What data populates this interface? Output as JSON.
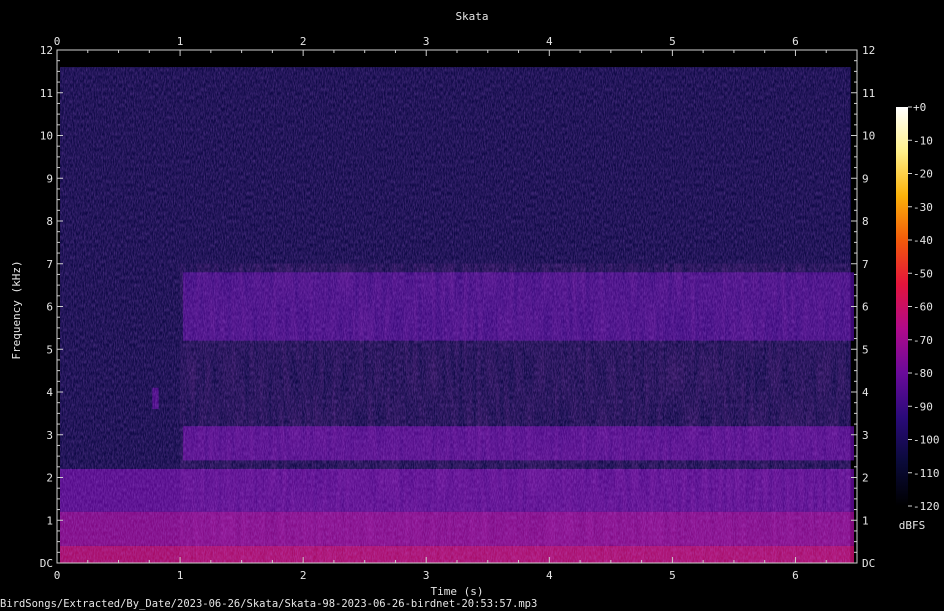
{
  "chart_data": {
    "type": "heatmap",
    "title": "Skata",
    "xlabel": "Time (s)",
    "ylabel": "Frequency (kHz)",
    "xlim": [
      0,
      6.5
    ],
    "ylim": [
      0,
      12
    ],
    "x_ticks": [
      "0",
      "1",
      "2",
      "3",
      "4",
      "5",
      "6"
    ],
    "y_ticks": [
      "DC",
      "1",
      "2",
      "3",
      "4",
      "5",
      "6",
      "7",
      "8",
      "9",
      "10",
      "11",
      "12"
    ],
    "colorbar": {
      "label": "dBFS",
      "range": [
        -120,
        0
      ],
      "ticks": [
        "+0",
        "-10",
        "-20",
        "-30",
        "-40",
        "-50",
        "-60",
        "-70",
        "-80",
        "-90",
        "-100",
        "-110",
        "-120"
      ],
      "stops": [
        "#000000",
        "#0a0a3a",
        "#2a0a7a",
        "#6a0a9a",
        "#b00a8a",
        "#e4143c",
        "#f25a0a",
        "#fbb20a",
        "#fff08a",
        "#ffffff"
      ]
    },
    "colormap": "inferno-like",
    "grid": false,
    "bands": [
      {
        "time_start": 0.0,
        "time_end": 6.5,
        "freq_low": 0.0,
        "freq_high": 0.4,
        "level_dbfs": -62
      },
      {
        "time_start": 0.0,
        "time_end": 6.5,
        "freq_low": 0.4,
        "freq_high": 1.2,
        "level_dbfs": -72
      },
      {
        "time_start": 0.0,
        "time_end": 6.5,
        "freq_low": 1.2,
        "freq_high": 2.2,
        "level_dbfs": -82
      },
      {
        "time_start": 1.0,
        "time_end": 6.5,
        "freq_low": 2.4,
        "freq_high": 3.2,
        "level_dbfs": -84
      },
      {
        "time_start": 1.0,
        "time_end": 6.5,
        "freq_low": 5.2,
        "freq_high": 6.8,
        "level_dbfs": -88
      },
      {
        "time_start": 0.75,
        "time_end": 0.85,
        "freq_low": 3.6,
        "freq_high": 4.1,
        "level_dbfs": -85
      }
    ]
  },
  "footer": {
    "file_path": "BirdSongs/Extracted/By_Date/2023-06-26/Skata/Skata-98-2023-06-26-birdnet-20:53:57.mp3"
  }
}
